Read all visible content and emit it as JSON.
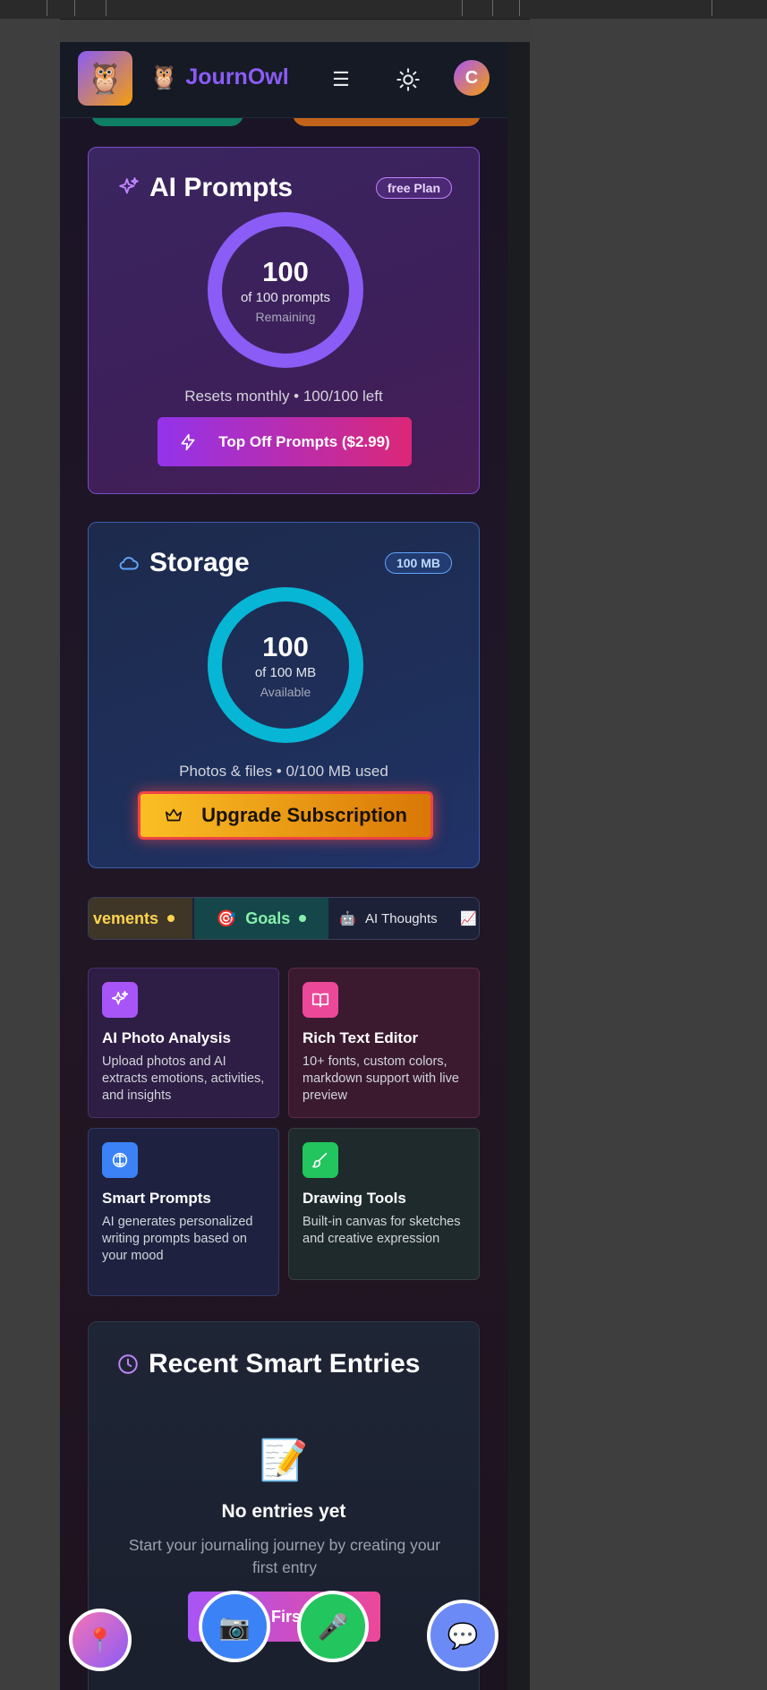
{
  "header": {
    "logo_emoji": "🦉",
    "brand_emoji": "🦉",
    "brand_name": "JournOwl",
    "menu_icon": "☰",
    "avatar_initial": "C"
  },
  "ai_prompts": {
    "title": "AI Prompts",
    "plan_badge": "free Plan",
    "ring_value": "100",
    "ring_sub": "of 100 prompts",
    "ring_label": "Remaining",
    "note": "Resets monthly • 100/100 left",
    "button_label": "Top Off Prompts ($2.99)"
  },
  "storage": {
    "title": "Storage",
    "badge": "100 MB",
    "ring_value": "100",
    "ring_sub": "of 100 MB",
    "ring_label": "Available",
    "note": "Photos & files • 0/100 MB used",
    "button_label": "Upgrade Subscription"
  },
  "tabs": {
    "achievements": "vements",
    "goals_icon": "🎯",
    "goals": "Goals",
    "ai_icon": "🤖",
    "ai_thoughts": "AI Thoughts",
    "chart_icon": "📈"
  },
  "features": [
    {
      "title": "AI Photo Analysis",
      "desc": "Upload photos and AI extracts emotions, activities, and insights"
    },
    {
      "title": "Rich Text Editor",
      "desc": "10+ fonts, custom colors, markdown support with live preview"
    },
    {
      "title": "Smart Prompts",
      "desc": "AI generates personalized writing prompts based on your mood"
    },
    {
      "title": "Drawing Tools",
      "desc": "Built-in canvas for sketches and creative expression"
    }
  ],
  "recent": {
    "title": "Recent Smart Entries",
    "empty_icon": "📝",
    "empty_title": "No entries yet",
    "empty_text": "Start your journaling journey by creating your first entry",
    "create_button": "Create First Entry"
  },
  "fabs": {
    "pin": "📍",
    "camera": "📷",
    "mic": "🎤",
    "chat": "💬"
  },
  "colors": {
    "brand": "#8b5cf6",
    "ai_ring": "#8b5cf6",
    "storage_ring": "#06b6d4",
    "upgrade": "#fbbf24"
  }
}
